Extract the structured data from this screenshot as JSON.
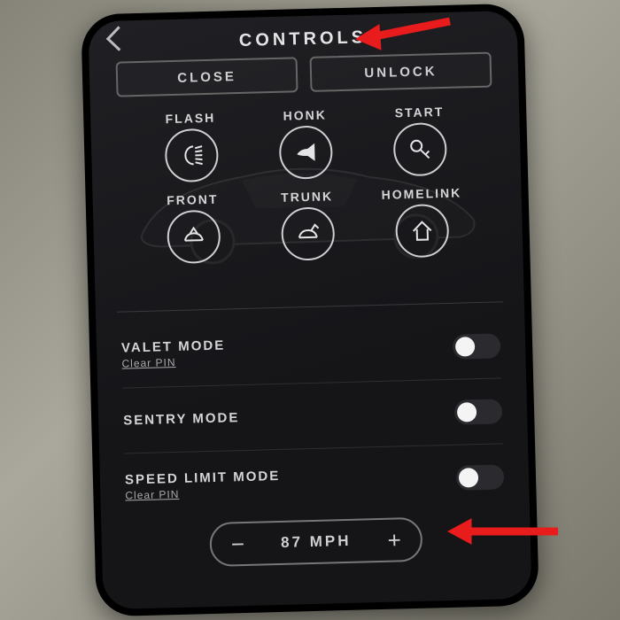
{
  "header": {
    "title": "CONTROLS"
  },
  "buttons": {
    "close": "CLOSE",
    "unlock": "UNLOCK"
  },
  "actions": {
    "flash": "FLASH",
    "honk": "HONK",
    "start": "START",
    "front": "FRONT",
    "trunk": "TRUNK",
    "homelink": "HOMELINK"
  },
  "settings": {
    "valet": {
      "title": "VALET MODE",
      "sub": "Clear PIN"
    },
    "sentry": {
      "title": "SENTRY MODE"
    },
    "speed_limit": {
      "title": "SPEED LIMIT MODE",
      "sub": "Clear PIN"
    }
  },
  "speed": {
    "value": "87 MPH",
    "minus": "−",
    "plus": "+"
  },
  "annotations": {
    "arrow_color": "#e81c1c"
  }
}
